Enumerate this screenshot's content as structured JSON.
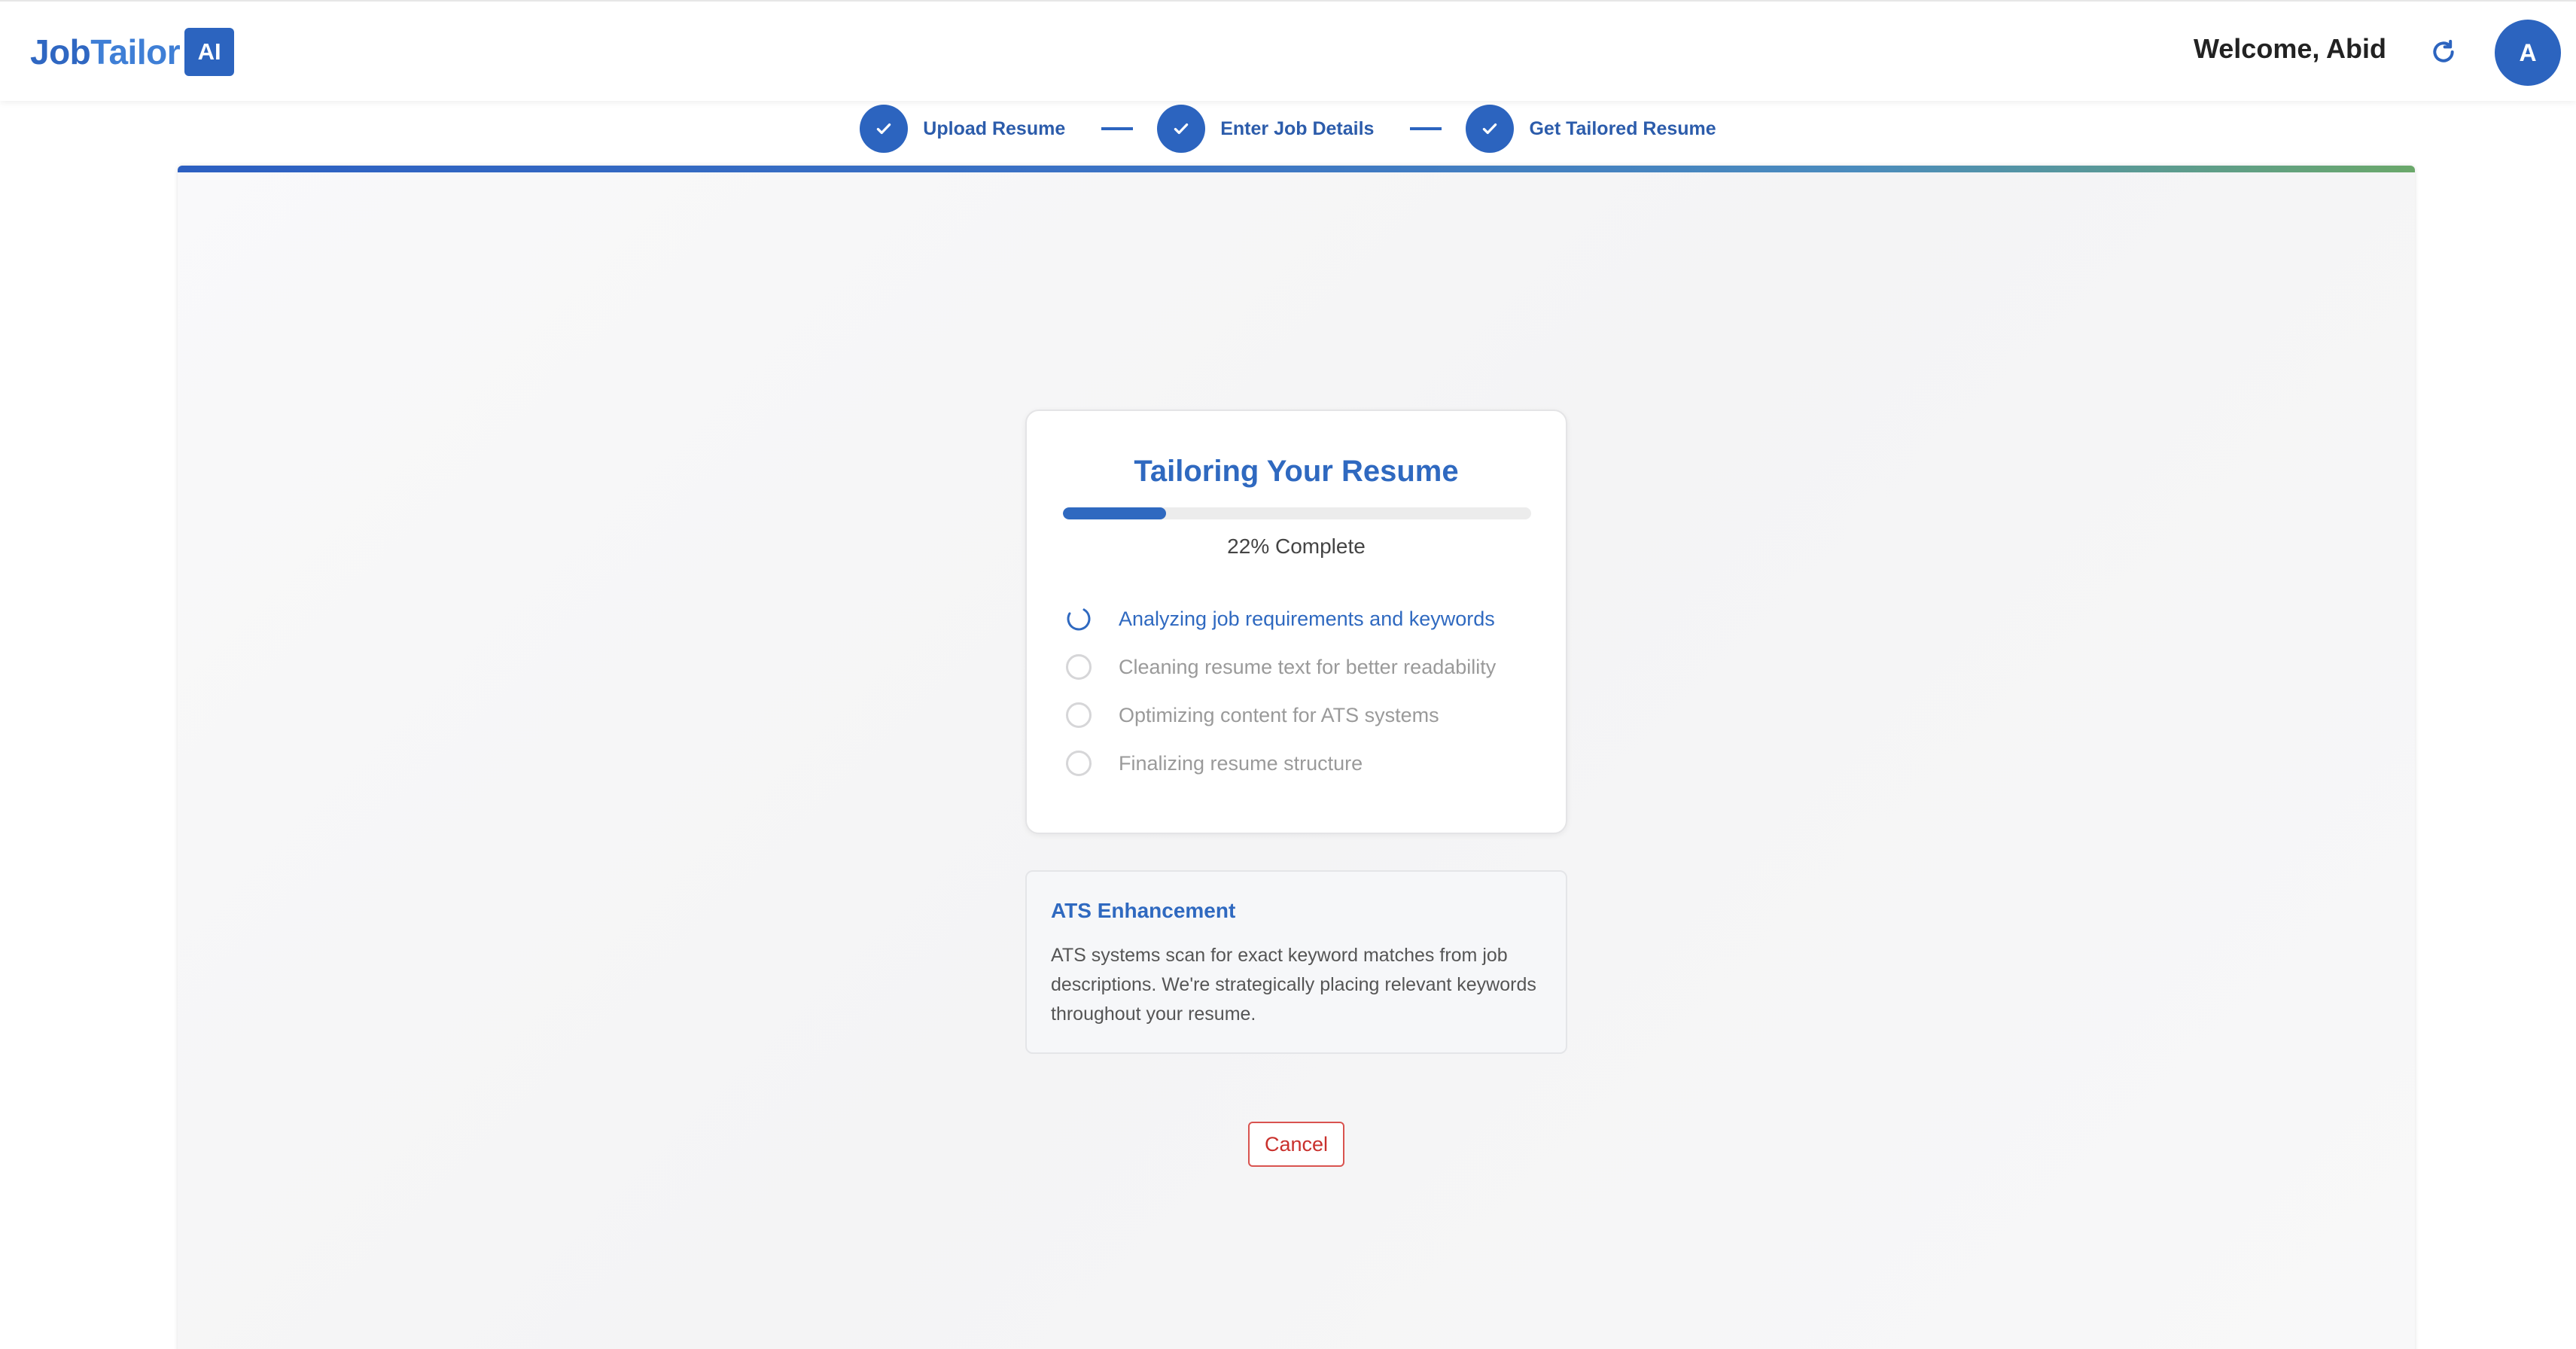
{
  "header": {
    "brand_main": "Job",
    "brand_accent": "Tailor",
    "brand_badge": "AI",
    "welcome_text": "Welcome, Abid",
    "refresh_icon": "refresh-icon",
    "avatar_initial": "A"
  },
  "stepper": {
    "steps": [
      {
        "label": "Upload Resume",
        "status": "complete"
      },
      {
        "label": "Enter Job Details",
        "status": "complete"
      },
      {
        "label": "Get Tailored Resume",
        "status": "complete"
      }
    ]
  },
  "progress": {
    "title": "Tailoring Your Resume",
    "percent": 22,
    "percent_label": "22% Complete",
    "tasks": [
      {
        "label": "Analyzing job requirements and keywords",
        "status": "active"
      },
      {
        "label": "Cleaning resume text for better readability",
        "status": "pending"
      },
      {
        "label": "Optimizing content for ATS systems",
        "status": "pending"
      },
      {
        "label": "Finalizing resume structure",
        "status": "pending"
      }
    ]
  },
  "tip": {
    "title": "ATS Enhancement",
    "body": "ATS systems scan for exact keyword matches from job descriptions. We're strategically placing relevant keywords throughout your resume."
  },
  "actions": {
    "cancel_label": "Cancel"
  },
  "colors": {
    "brand_blue": "#2c64bf",
    "accent_blue": "#2f69c0",
    "danger": "#d9534f",
    "muted_text": "#9a9a9a"
  }
}
